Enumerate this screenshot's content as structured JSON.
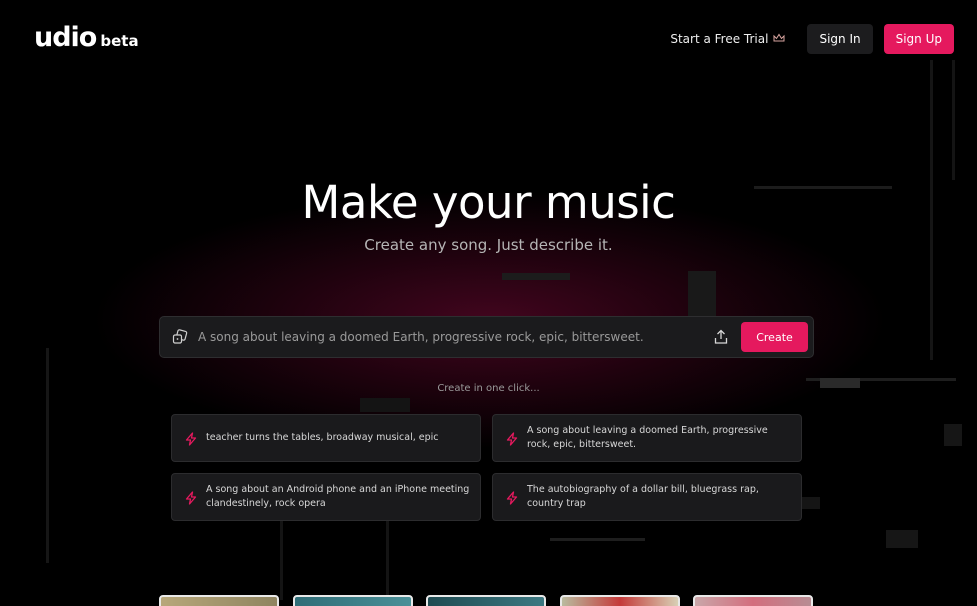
{
  "logo": {
    "main": "udio",
    "sub": "beta"
  },
  "nav": {
    "trial_label": "Start a Free Trial",
    "trial_icon": "crown-icon",
    "signin_label": "Sign In",
    "signup_label": "Sign Up"
  },
  "hero": {
    "title": "Make your music",
    "subtitle": "Create any song. Just describe it."
  },
  "prompt": {
    "placeholder": "A song about leaving a doomed Earth, progressive rock, epic, bittersweet.",
    "create_label": "Create"
  },
  "one_click_label": "Create in one click...",
  "suggestions": [
    {
      "text": "teacher turns the tables, broadway musical, epic"
    },
    {
      "text": "A song about leaving a doomed Earth, progressive rock, epic, bittersweet."
    },
    {
      "text": "A song about an Android phone and an iPhone meeting clandestinely, rock opera"
    },
    {
      "text": "The autobiography of a dollar bill, bluegrass rap, country trap"
    }
  ],
  "colors": {
    "accent": "#e5195e",
    "background": "#000000",
    "card": "#1a1a1c"
  }
}
